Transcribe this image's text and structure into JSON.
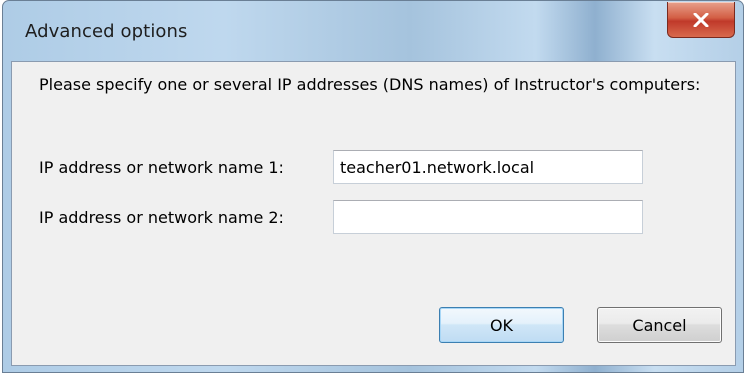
{
  "window": {
    "title": "Advanced options",
    "close_icon": "close-x-icon"
  },
  "dialog": {
    "prompt": "Please specify one or several IP addresses (DNS names) of Instructor's computers:",
    "fields": [
      {
        "label": "IP address or network name 1:",
        "value": "teacher01.network.local",
        "placeholder": ""
      },
      {
        "label": "IP address or network name 2:",
        "value": "",
        "placeholder": ""
      }
    ],
    "ok_label": "OK",
    "cancel_label": "Cancel"
  },
  "colors": {
    "close_button": "#c0392a",
    "client_background": "#f0f0f0",
    "default_button_border": "#3c7fb1"
  }
}
